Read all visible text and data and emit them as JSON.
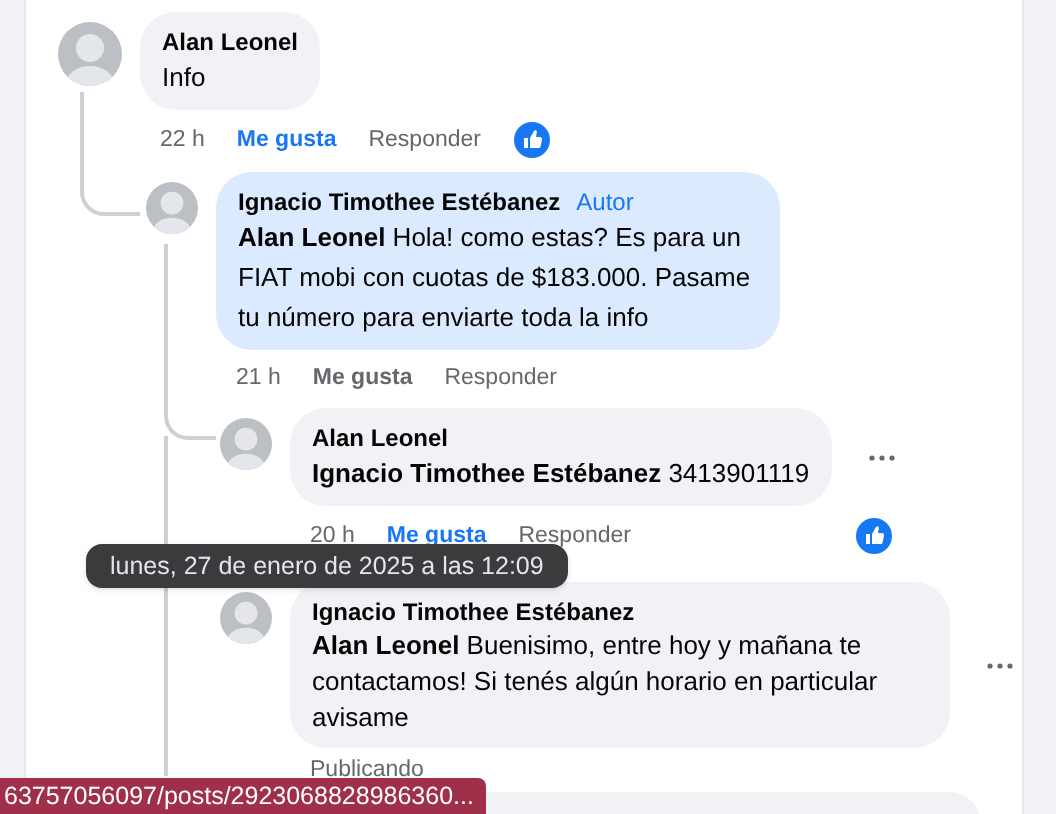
{
  "comments": [
    {
      "author": "Alan Leonel",
      "text": "Info",
      "time": "22 h",
      "like": "Me gusta",
      "liked": true,
      "reply": "Responder",
      "reaction": true,
      "children": [
        {
          "author": "Ignacio Timothee Estébanez",
          "badge": "Autor",
          "highlighted": true,
          "text": "**Alan Leonel** Hola! como estas? Es para un FIAT mobi con cuotas de $183.000. Pasame tu número para enviarte toda la info",
          "time": "21 h",
          "like": "Me gusta",
          "liked": false,
          "reply": "Responder",
          "children": [
            {
              "author": "Alan Leonel",
              "highlighted": false,
              "text": "**Ignacio Timothee Estébanez** 3413901119",
              "time": "20 h",
              "like": "Me gusta",
              "liked": true,
              "reply": "Responder",
              "reaction": true,
              "menu_visible": true,
              "time_hovered": true
            },
            {
              "author": "Ignacio Timothee Estébanez",
              "highlighted": false,
              "text": "**Alan Leonel** Buenisimo, entre hoy y mañana te contactamos! Si tenés algún horario en particular avisame",
              "status": "Publicando",
              "menu_visible": true
            }
          ]
        }
      ]
    }
  ],
  "tooltip": "lunes, 27 de enero de 2025 a las 12:09",
  "status_url": "63757056097/posts/2923068828986360..."
}
